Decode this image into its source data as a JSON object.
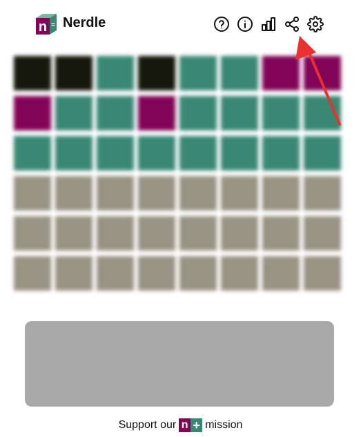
{
  "app": {
    "title": "Nerdle",
    "logo_letter": "n"
  },
  "toolbar": {
    "icons": [
      "help-icon",
      "info-icon",
      "stats-icon",
      "share-icon",
      "settings-icon"
    ]
  },
  "board": {
    "rows": [
      [
        "black",
        "black",
        "green",
        "black",
        "green",
        "green",
        "purple",
        "purple"
      ],
      [
        "purple",
        "green",
        "green",
        "purple",
        "green",
        "green",
        "green",
        "green"
      ],
      [
        "green",
        "green",
        "green",
        "green",
        "green",
        "green",
        "green",
        "green"
      ],
      [
        "empty",
        "empty",
        "empty",
        "empty",
        "empty",
        "empty",
        "empty",
        "empty"
      ],
      [
        "empty",
        "empty",
        "empty",
        "empty",
        "empty",
        "empty",
        "empty",
        "empty"
      ],
      [
        "empty",
        "empty",
        "empty",
        "empty",
        "empty",
        "empty",
        "empty",
        "empty"
      ]
    ],
    "colors": {
      "black": "#16180b",
      "green": "#398874",
      "purple": "#820458",
      "empty": "#989484"
    }
  },
  "footer": {
    "prefix": "Support our",
    "badge_n": "n",
    "badge_plus": "+",
    "suffix": "mission"
  },
  "annotation": {
    "arrow_color": "#e8312f"
  }
}
